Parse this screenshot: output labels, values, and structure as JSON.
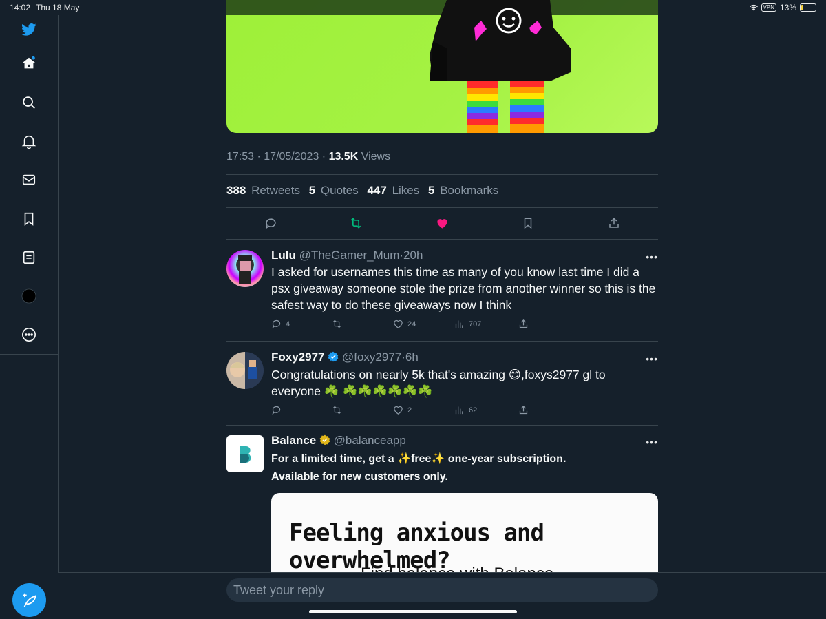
{
  "status_bar": {
    "time": "14:02",
    "date": "Thu 18 May",
    "vpn": "VPN",
    "battery": "13%"
  },
  "sidebar": {
    "items": [
      "twitter-logo",
      "home",
      "search",
      "notifications",
      "messages",
      "bookmarks",
      "lists",
      "profile",
      "more"
    ]
  },
  "tweet": {
    "time": "17:53",
    "date": "17/05/2023",
    "views_count": "13.5K",
    "views_label": "Views",
    "retweets_count": "388",
    "retweets_label": "Retweets",
    "quotes_count": "5",
    "quotes_label": "Quotes",
    "likes_count": "447",
    "likes_label": "Likes",
    "bookmarks_count": "5",
    "bookmarks_label": "Bookmarks"
  },
  "replies": [
    {
      "name": "Lulu",
      "handle": "@TheGamer_Mum",
      "time": "20h",
      "text": "I asked for usernames this time as many of you know last time I did a psx giveaway someone stole the prize from another winner so this is the safest way to do these giveaways now I think",
      "replies": "4",
      "retweets": "",
      "likes": "24",
      "views": "707"
    },
    {
      "name": "Foxy2977",
      "handle": "@foxy2977",
      "time": "6h",
      "text": "Congratulations on nearly 5k that's amazing 😊,foxys2977 gl to everyone ☘️ ☘️☘️☘️☘️☘️☘️",
      "replies": "",
      "retweets": "",
      "likes": "2",
      "views": "62"
    }
  ],
  "ad": {
    "name": "Balance",
    "handle": "@balanceapp",
    "line1": "For a limited time, get a ✨free✨ one-year subscription.",
    "line2": "Available for new customers only.",
    "card_headline": "Feeling anxious and overwhelmed?",
    "card_sub": "Find balance with Balance"
  },
  "composer": {
    "placeholder": "Tweet your reply"
  },
  "colors": {
    "background": "#15202b",
    "accent": "#1d9bf0",
    "like": "#f91880",
    "retweet": "#00ba7c"
  }
}
